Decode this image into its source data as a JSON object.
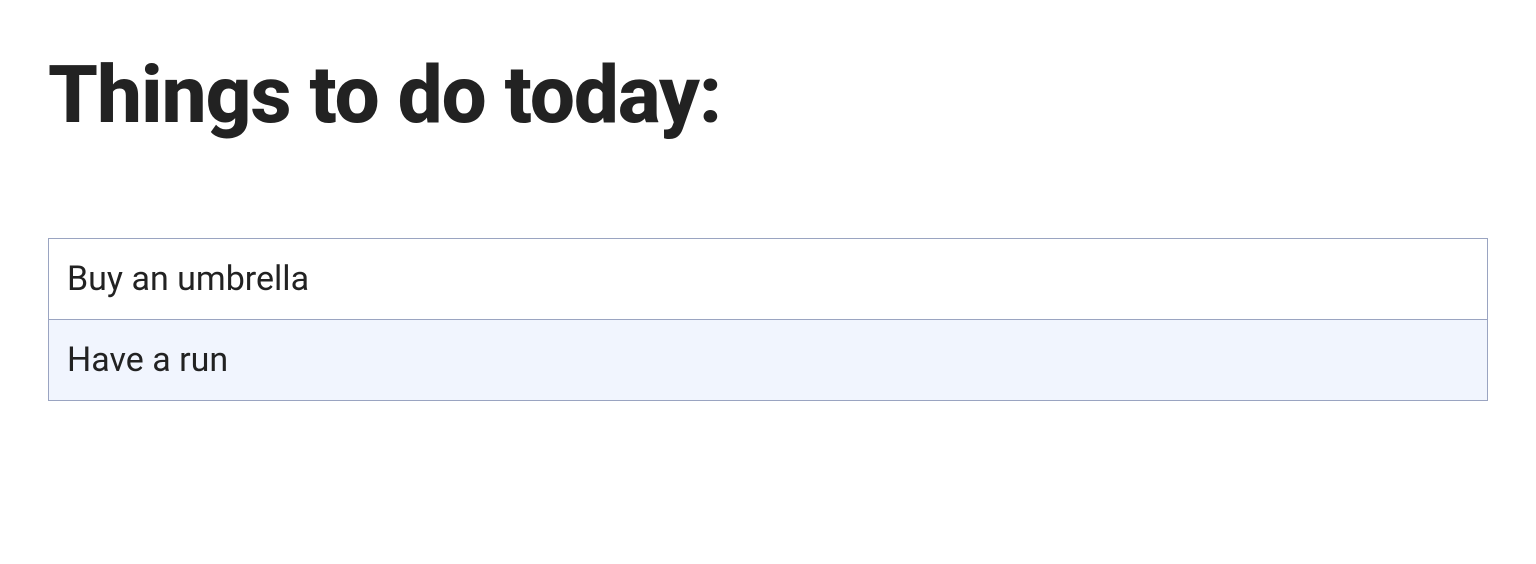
{
  "title": "Things to do today:",
  "items": [
    {
      "label": "Buy an umbrella"
    },
    {
      "label": "Have a run"
    }
  ]
}
